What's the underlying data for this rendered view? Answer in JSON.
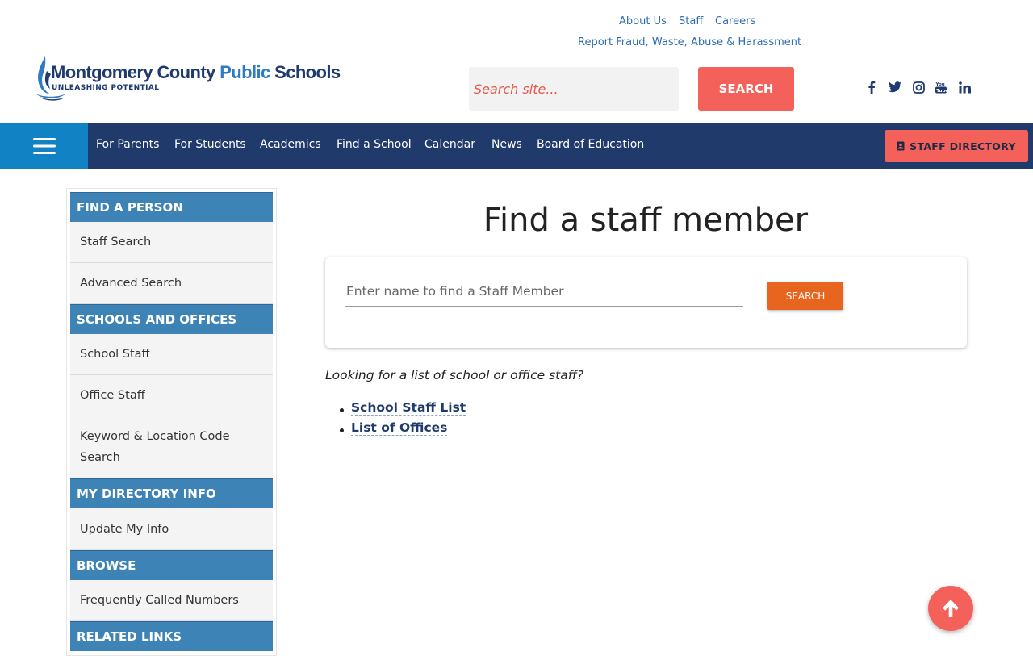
{
  "header": {
    "logo": {
      "name_part1": "Montgomery County ",
      "name_part2": "Public",
      "name_part3": " Schools",
      "tagline": "UNLEASHING POTENTIAL"
    },
    "utility_links": {
      "about": "About Us",
      "staff": "Staff",
      "careers": "Careers",
      "report": "Report Fraud, Waste, Abuse & Harassment"
    },
    "search": {
      "placeholder": "Search site...",
      "button_label": "SEARCH"
    },
    "social_icons": [
      "facebook-icon",
      "twitter-icon",
      "instagram-icon",
      "youtube-icon",
      "linkedin-icon"
    ]
  },
  "nav": {
    "items": [
      "For Parents",
      "For Students",
      "Academics",
      "Find a School",
      "Calendar",
      "News",
      "Board of Education"
    ],
    "staff_directory_label": "STAFF DIRECTORY"
  },
  "sidebar": {
    "sections": [
      {
        "title": "FIND A PERSON",
        "items": [
          "Staff Search",
          "Advanced Search"
        ]
      },
      {
        "title": "SCHOOLS AND OFFICES",
        "items": [
          "School Staff",
          "Office Staff",
          "Keyword & Location Code Search"
        ]
      },
      {
        "title": "MY DIRECTORY INFO",
        "items": [
          "Update My Info"
        ]
      },
      {
        "title": "BROWSE",
        "items": [
          "Frequently Called Numbers"
        ]
      },
      {
        "title": "RELATED LINKS",
        "items": []
      }
    ]
  },
  "main": {
    "title": "Find a staff member",
    "staff_search": {
      "placeholder": "Enter name to find a Staff Member",
      "button_label": "SEARCH"
    },
    "lookup_text": "Looking for a list of school or office staff?",
    "links": [
      "School Staff List",
      "List of Offices"
    ]
  },
  "colors": {
    "navy": "#1f3a6b",
    "light_blue": "#1183c4",
    "section_blue": "#3e83b5",
    "coral": "#f4605a",
    "orange": "#e8651f"
  }
}
